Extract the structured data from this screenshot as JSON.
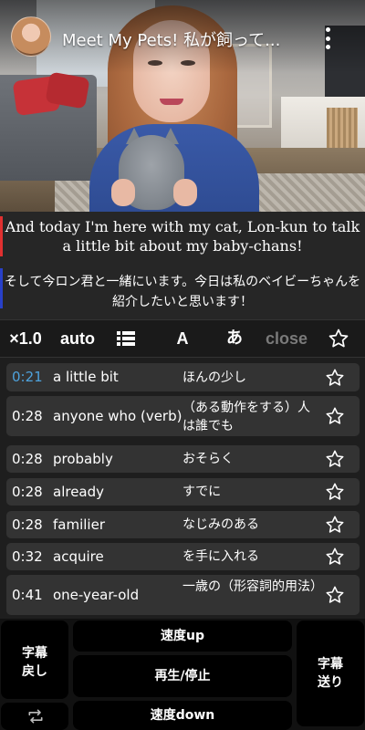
{
  "video": {
    "title": "Meet My Pets! 私が飼って..."
  },
  "subtitles": {
    "english": "And today I'm here with my cat, Lon-kun to talk a little bit about my baby-chans!",
    "japanese": "そして今ロン君と一緒にいます。今日は私のベイビーちゃんを紹介したいと思います！"
  },
  "toolbar": {
    "speed_label": "×1.0",
    "auto_label": "auto",
    "font_label": "A",
    "kana_label": "あ",
    "close_label": "close"
  },
  "vocab": [
    {
      "time": "0:21",
      "en": "a little bit",
      "ja": "ほんの少し",
      "active": true
    },
    {
      "time": "0:28",
      "en": "anyone who (verb)",
      "ja": "（ある動作をする）人は誰でも",
      "active": false
    },
    {
      "time": "0:28",
      "en": "probably",
      "ja": "おそらく",
      "active": false
    },
    {
      "time": "0:28",
      "en": "already",
      "ja": "すでに",
      "active": false
    },
    {
      "time": "0:28",
      "en": "familier",
      "ja": "なじみのある",
      "active": false
    },
    {
      "time": "0:32",
      "en": "acquire",
      "ja": "を手に入れる",
      "active": false
    },
    {
      "time": "0:41",
      "en": "one-year-old",
      "ja": "一歳の（形容詞的用法）",
      "active": false
    }
  ],
  "controls": {
    "back_label_line1": "字幕",
    "back_label_line2": "戻し",
    "forward_label_line1": "字幕",
    "forward_label_line2": "送り",
    "speed_up_label": "速度up",
    "play_pause_label": "再生/停止",
    "speed_down_label": "速度down"
  },
  "colors": {
    "active_time": "#4ea2dc",
    "row_background": "#333333",
    "subtitle_en_bar": "#e03030",
    "subtitle_ja_bar": "#2840c8",
    "close_disabled": "#7a7a7a"
  },
  "icons": {
    "menu": "kebab-menu-icon",
    "list": "list-icon",
    "star": "star-outline-icon",
    "repeat": "repeat-icon"
  }
}
